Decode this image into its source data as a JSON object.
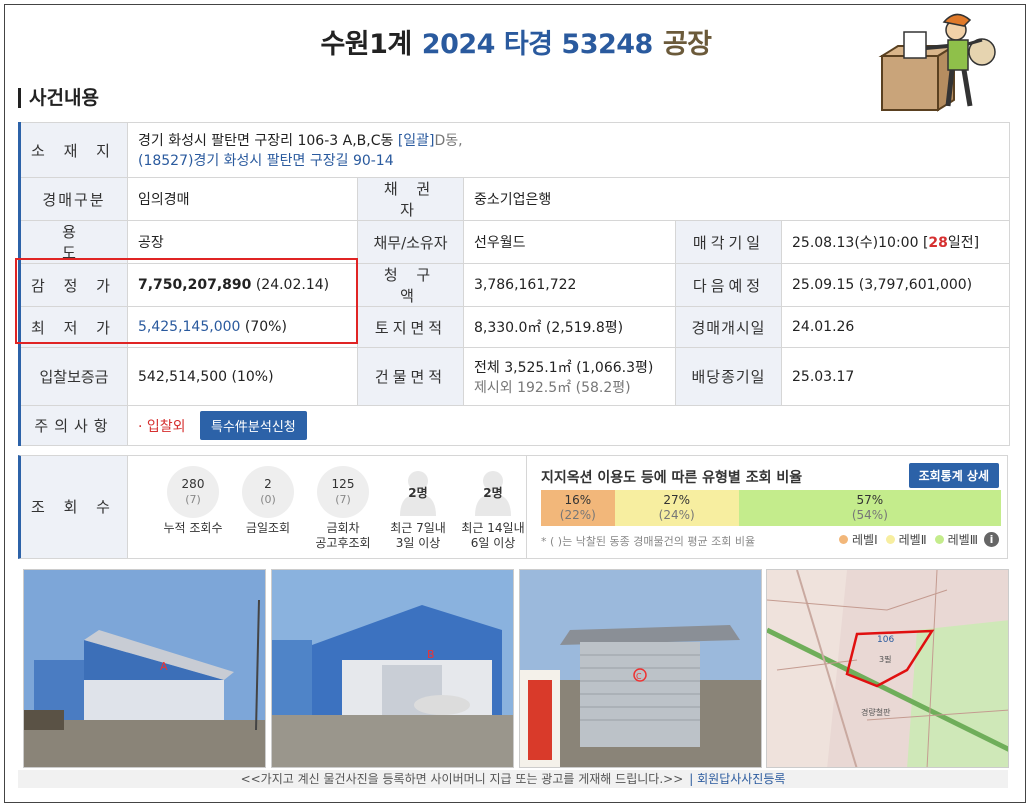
{
  "header": {
    "court": "수원1계",
    "case_no": "2024 타경 53248",
    "kind": "공장"
  },
  "section_title": "사건내용",
  "info": {
    "location": {
      "label": "소 재 지",
      "line1": "경기 화성시 팔탄면 구장리 106-3 A,B,C동",
      "tag": "[일괄]",
      "tag_tail": "D동,",
      "line2": "(18527)경기 화성시  팔탄면 구장길  90-14"
    },
    "auction_type": {
      "label": "경매구분",
      "value": "임의경매"
    },
    "creditor": {
      "label": "채 권 자",
      "value": "중소기업은행"
    },
    "usage": {
      "label": "용 도",
      "value": "공장"
    },
    "debtor": {
      "label": "채무/소유자",
      "value": "선우월드"
    },
    "sale_date": {
      "label": "매각기일",
      "value": "25.08.13(수)10:00 [",
      "days": "28",
      "suffix": "일전]"
    },
    "appraisal": {
      "label": "감 정 가",
      "value": "7,750,207,890",
      "date": " (24.02.14)"
    },
    "claim": {
      "label": "청 구 액",
      "value": "3,786,161,722"
    },
    "next_date": {
      "label": "다음예정",
      "value": "25.09.15 (3,797,601,000)"
    },
    "minimum": {
      "label": "최 저 가",
      "value": "5,425,145,000",
      "pct": " (70%)"
    },
    "land_area": {
      "label": "토지면적",
      "value": "8,330.0㎡ (2,519.8평)"
    },
    "auction_start": {
      "label": "경매개시일",
      "value": "24.01.26"
    },
    "deposit": {
      "label": "입찰보증금",
      "value": "542,514,500 (10%)"
    },
    "building_area": {
      "label": "건물면적",
      "line1": "전체 3,525.1㎡ (1,066.3평)",
      "line2": "제시외 192.5㎡ (58.2평)"
    },
    "dividend_end": {
      "label": "배당종기일",
      "value": "25.03.17"
    },
    "notes": {
      "label": "주의사항",
      "value": "· 입찰외",
      "button": "특수件분석신청"
    }
  },
  "views": {
    "label": "조 회 수",
    "stats": [
      {
        "big": "280",
        "small": "(7)",
        "cap1": "누적 조회수",
        "cap2": ""
      },
      {
        "big": "2",
        "small": "(0)",
        "cap1": "금일조회",
        "cap2": ""
      },
      {
        "big": "125",
        "small": "(7)",
        "cap1": "금회차",
        "cap2": "공고후조회"
      },
      {
        "big": "2명",
        "small": "",
        "cap1": "최근 7일내",
        "cap2": "3일 이상"
      },
      {
        "big": "2명",
        "small": "",
        "cap1": "최근 14일내",
        "cap2": "6일 이상"
      }
    ],
    "ratio": {
      "title": "지지옥션 이용도 등에 따른 유형별 조회 비율",
      "button": "조회통계 상세",
      "bars": [
        {
          "pct": "16%",
          "avg": "(22%)",
          "share": 16,
          "color": "#f2b77a"
        },
        {
          "pct": "27%",
          "avg": "(24%)",
          "share": 27,
          "color": "#f7eea0"
        },
        {
          "pct": "57%",
          "avg": "(54%)",
          "share": 57,
          "color": "#c4ec8c"
        }
      ],
      "footnote": "* ( )는 낙찰된 동종 경매물건의 평균 조회 비율",
      "legend": [
        "레벨Ⅰ",
        "레벨Ⅱ",
        "레벨Ⅲ"
      ],
      "legend_colors": [
        "#f2b77a",
        "#f7eea0",
        "#c4ec8c"
      ]
    }
  },
  "photos": {
    "labels": [
      "A",
      "B",
      "C"
    ],
    "caption": "<<가지고 계신 물건사진을 등록하면 사이버머니 지급 또는 광고를 게재해 드립니다.>>",
    "caption_link": "| 회원답사사진등록"
  },
  "map": {
    "labels": [
      "106",
      "3필",
      "경량철판"
    ]
  }
}
